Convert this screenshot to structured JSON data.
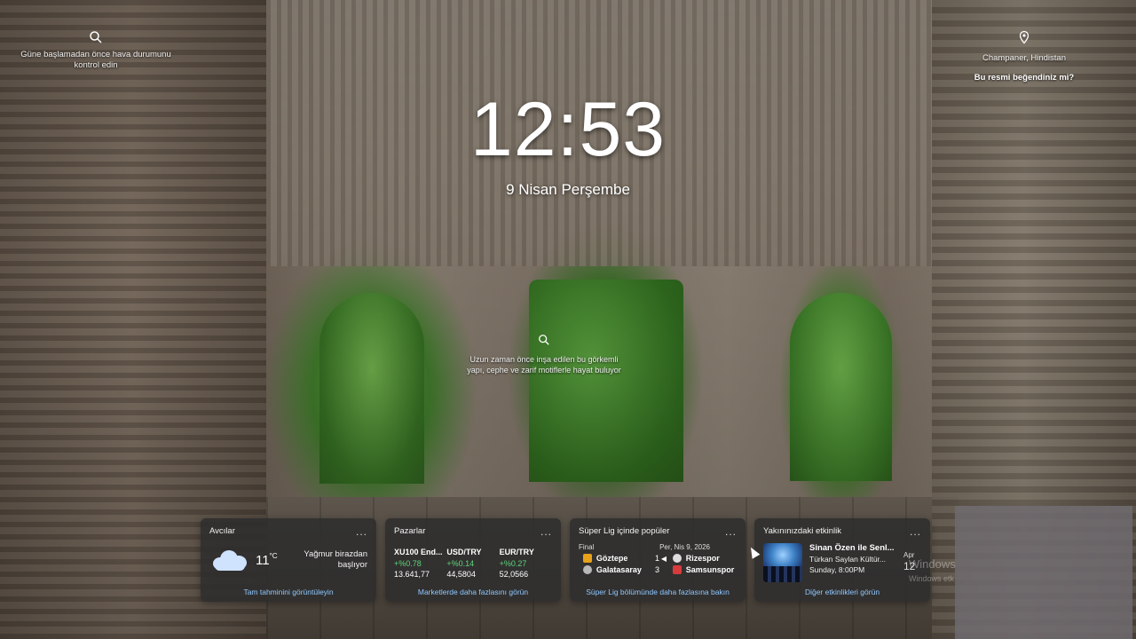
{
  "top_left": {
    "icon": "search-icon",
    "text": "Güne başlamadan önce hava durumunu kontrol edin"
  },
  "top_right": {
    "icon": "location-pin-icon",
    "location": "Champaner, Hindistan",
    "like_prompt": "Bu resmi beğendiniz mi?"
  },
  "clock": {
    "time": "12:53",
    "date": "9 Nisan Perşembe"
  },
  "center_fact": {
    "icon": "search-icon",
    "text": "Uzun zaman önce inşa edilen bu görkemli yapı, cephe ve zarif motiflerle hayat buluyor"
  },
  "widgets": {
    "weather": {
      "title": "Avcılar",
      "more": "...",
      "temp": "11",
      "unit": "°C",
      "condition": "Yağmur birazdan başlıyor",
      "link": "Tam tahminini görüntüleyin",
      "icon": "cloud-icon"
    },
    "markets": {
      "title": "Pazarlar",
      "more": "...",
      "items": [
        {
          "name": "XU100 End...",
          "change": "+%0.78",
          "value": "13.641,77"
        },
        {
          "name": "USD/TRY",
          "change": "+%0.14",
          "value": "44,5804"
        },
        {
          "name": "EUR/TRY",
          "change": "+%0.27",
          "value": "52,0566"
        }
      ],
      "link": "Marketlerde daha fazlasını görün"
    },
    "league": {
      "title": "Süper Lig içinde popüler",
      "more": "...",
      "status": "Final",
      "date": "Per, Nis 9, 2026",
      "rows": [
        {
          "home": "Göztepe",
          "home_score": "1",
          "away": "Rizespor",
          "home_color": "#e8a21a",
          "away_color": "#dddddd"
        },
        {
          "home": "Galatasaray",
          "home_score": "3",
          "away": "Samsunspor",
          "home_color": "#b8b8b8",
          "away_color": "#d83b3b"
        }
      ],
      "link": "Süper Lig bölümünde daha fazlasına bakın"
    },
    "events": {
      "title": "Yakınınızdaki etkinlik",
      "more": "...",
      "event_title": "Sinan Özen ile Senl...",
      "venue": "Türkan Saylan Kültür...",
      "when": "Sunday, 8:00PM",
      "side_month": "Apr",
      "side_day": "12",
      "link": "Diğer etkinlikleri görün"
    }
  },
  "watermark": {
    "line1": "Windows",
    "line2": "Windows etk"
  }
}
